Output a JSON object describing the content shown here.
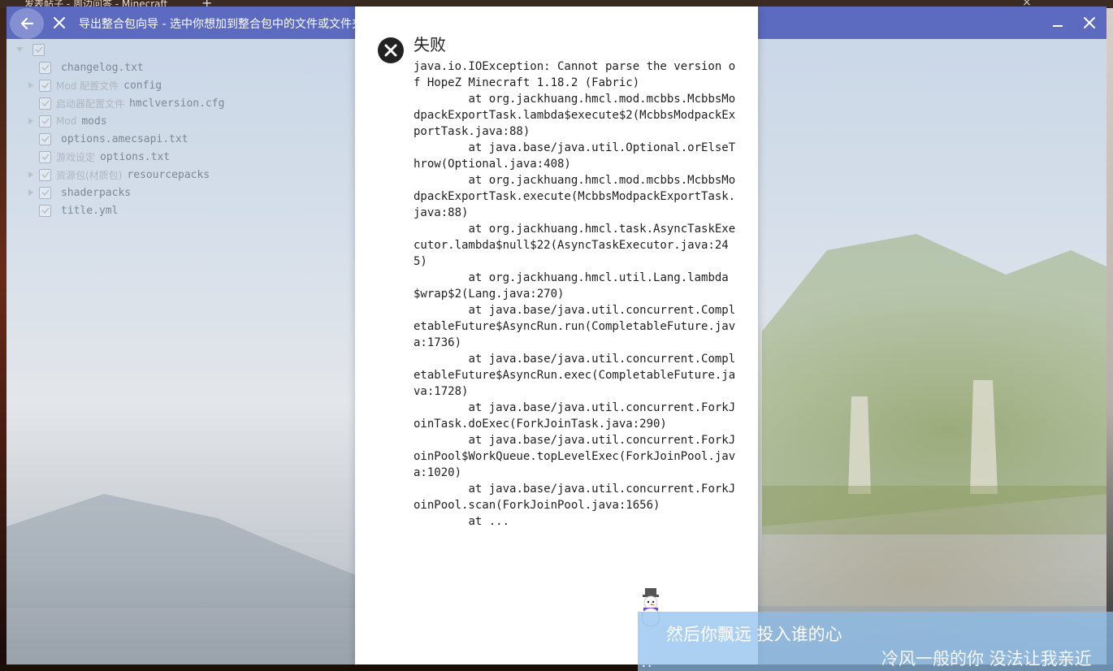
{
  "browser": {
    "tab_text": "发表帖子 - 周边问答 - Minecraft",
    "new_tab": "+",
    "close": "×"
  },
  "window": {
    "title": "导出整合包向导 - 选中你想加到整合包中的文件或文件夹",
    "icons": {
      "back": "arrow-left-icon",
      "close_page": "close-icon",
      "minimize": "minimize-icon",
      "close_window": "close-icon"
    }
  },
  "file_tree": {
    "items": [
      {
        "tag": "",
        "name": "",
        "expandable": true,
        "checked": true
      },
      {
        "tag": "",
        "name": "changelog.txt",
        "expandable": false,
        "checked": true
      },
      {
        "tag": "Mod 配置文件",
        "name": "config",
        "expandable": true,
        "checked": true
      },
      {
        "tag": "启动器配置文件",
        "name": "hmclversion.cfg",
        "expandable": false,
        "checked": true
      },
      {
        "tag": "Mod",
        "name": "mods",
        "expandable": true,
        "checked": true
      },
      {
        "tag": "",
        "name": "options.amecsapi.txt",
        "expandable": false,
        "checked": true
      },
      {
        "tag": "游戏设定",
        "name": "options.txt",
        "expandable": false,
        "checked": true
      },
      {
        "tag": "资源包(材质包)",
        "name": "resourcepacks",
        "expandable": true,
        "checked": true
      },
      {
        "tag": "",
        "name": "shaderpacks",
        "expandable": true,
        "checked": true
      },
      {
        "tag": "",
        "name": "title.yml",
        "expandable": false,
        "checked": true
      }
    ]
  },
  "dialog": {
    "icon": "error-circle-icon",
    "title": "失败",
    "message": "java.io.IOException: Cannot parse the version of HopeZ Minecraft 1.18.2 (Fabric)\n\tat org.jackhuang.hmcl.mod.mcbbs.McbbsModpackExportTask.lambda$execute$2(McbbsModpackExportTask.java:88)\n\tat java.base/java.util.Optional.orElseThrow(Optional.java:408)\n\tat org.jackhuang.hmcl.mod.mcbbs.McbbsModpackExportTask.execute(McbbsModpackExportTask.java:88)\n\tat org.jackhuang.hmcl.task.AsyncTaskExecutor.lambda$null$22(AsyncTaskExecutor.java:245)\n\tat org.jackhuang.hmcl.util.Lang.lambda$wrap$2(Lang.java:270)\n\tat java.base/java.util.concurrent.CompletableFuture$AsyncRun.run(CompletableFuture.java:1736)\n\tat java.base/java.util.concurrent.CompletableFuture$AsyncRun.exec(CompletableFuture.java:1728)\n\tat java.base/java.util.concurrent.ForkJoinTask.doExec(ForkJoinTask.java:290)\n\tat java.base/java.util.concurrent.ForkJoinPool$WorkQueue.topLevelExec(ForkJoinPool.java:1020)\n\tat java.base/java.util.concurrent.ForkJoinPool.scan(ForkJoinPool.java:1656)\n\tat ..."
  },
  "lyrics": {
    "line1": "然后你飘远 投入谁的心",
    "line2": "冷风一般的你 没法让我亲近",
    "dots": "• •"
  },
  "colors": {
    "titlebar": "#5c6bc0",
    "dialog_bg": "#ffffff",
    "error_icon": "#222222"
  }
}
